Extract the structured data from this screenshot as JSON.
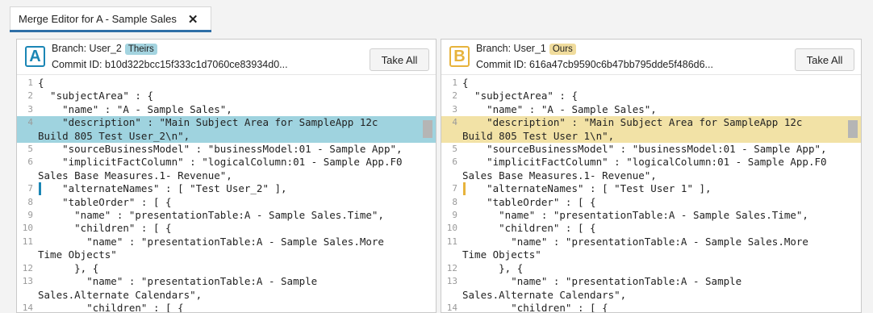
{
  "tab": {
    "title": "Merge Editor for A - Sample Sales",
    "close_glyph": "✕"
  },
  "left": {
    "badge": "A",
    "branch_label": "Branch: User_2",
    "pill": "Theirs",
    "commit": "Commit ID: b10d322bcc15f333c1d7060ce83934d0...",
    "take_all": "Take All",
    "lines": [
      {
        "n": "1",
        "t": "{"
      },
      {
        "n": "2",
        "t": "  \"subjectArea\" : {"
      },
      {
        "n": "3",
        "t": "    \"name\" : \"A - Sample Sales\","
      },
      {
        "n": "4",
        "t": "    \"description\" : \"Main Subject Area for SampleApp 12c"
      },
      {
        "n": "",
        "t": "Build 805 Test User_2\\n\","
      },
      {
        "n": "5",
        "t": "    \"sourceBusinessModel\" : \"businessModel:01 - Sample App\","
      },
      {
        "n": "6",
        "t": "    \"implicitFactColumn\" : \"logicalColumn:01 - Sample App.F0"
      },
      {
        "n": "",
        "t": "Sales Base Measures.1- Revenue\","
      },
      {
        "n": "7",
        "t": "    \"alternateNames\" : [ \"Test User_2\" ],"
      },
      {
        "n": "8",
        "t": "    \"tableOrder\" : [ {"
      },
      {
        "n": "9",
        "t": "      \"name\" : \"presentationTable:A - Sample Sales.Time\","
      },
      {
        "n": "10",
        "t": "      \"children\" : [ {"
      },
      {
        "n": "11",
        "t": "        \"name\" : \"presentationTable:A - Sample Sales.More"
      },
      {
        "n": "",
        "t": "Time Objects\""
      },
      {
        "n": "12",
        "t": "      }, {"
      },
      {
        "n": "13",
        "t": "        \"name\" : \"presentationTable:A - Sample"
      },
      {
        "n": "",
        "t": "Sales.Alternate Calendars\","
      },
      {
        "n": "14",
        "t": "        \"children\" : [ {"
      }
    ]
  },
  "right": {
    "badge": "B",
    "branch_label": "Branch: User_1",
    "pill": "Ours",
    "commit": "Commit ID: 616a47cb9590c6b47bb795dde5f486d6...",
    "take_all": "Take All",
    "lines": [
      {
        "n": "1",
        "t": "{"
      },
      {
        "n": "2",
        "t": "  \"subjectArea\" : {"
      },
      {
        "n": "3",
        "t": "    \"name\" : \"A - Sample Sales\","
      },
      {
        "n": "4",
        "t": "    \"description\" : \"Main Subject Area for SampleApp 12c"
      },
      {
        "n": "",
        "t": "Build 805 Test User 1\\n\","
      },
      {
        "n": "5",
        "t": "    \"sourceBusinessModel\" : \"businessModel:01 - Sample App\","
      },
      {
        "n": "6",
        "t": "    \"implicitFactColumn\" : \"logicalColumn:01 - Sample App.F0"
      },
      {
        "n": "",
        "t": "Sales Base Measures.1- Revenue\","
      },
      {
        "n": "7",
        "t": "    \"alternateNames\" : [ \"Test User 1\" ],"
      },
      {
        "n": "8",
        "t": "    \"tableOrder\" : [ {"
      },
      {
        "n": "9",
        "t": "      \"name\" : \"presentationTable:A - Sample Sales.Time\","
      },
      {
        "n": "10",
        "t": "      \"children\" : [ {"
      },
      {
        "n": "11",
        "t": "        \"name\" : \"presentationTable:A - Sample Sales.More"
      },
      {
        "n": "",
        "t": "Time Objects\""
      },
      {
        "n": "12",
        "t": "      }, {"
      },
      {
        "n": "13",
        "t": "        \"name\" : \"presentationTable:A - Sample"
      },
      {
        "n": "",
        "t": "Sales.Alternate Calendars\","
      },
      {
        "n": "14",
        "t": "        \"children\" : [ {"
      }
    ]
  },
  "colors": {
    "theirs_accent": "#1b86b5",
    "ours_accent": "#e7b33c",
    "theirs_highlight": "#9fd3df",
    "ours_highlight": "#f2e2a6"
  }
}
